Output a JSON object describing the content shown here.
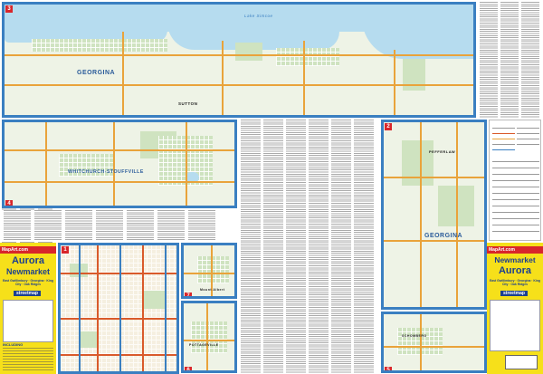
{
  "cover_left": {
    "brand": "MapArt.com",
    "title_1": "Aurora",
    "title_2": "Newmarket",
    "subtitle": "East Gwillimbury · Georgina · King City · Oak Ridges",
    "product": "streetmap",
    "including": "INCLUDING"
  },
  "cover_right": {
    "brand": "MapArt.com",
    "title_1": "Newmarket",
    "title_2": "Aurora",
    "subtitle": "East Gwillimbury · Georgina · King City · Oak Ridges",
    "product": "streetmap"
  },
  "panels": {
    "georgina_north": {
      "title": "GEORGINA",
      "number": "3",
      "towns": [
        "SUTTON"
      ],
      "water": "Lake Simcoe"
    },
    "whitchurch": {
      "title": "WHITCHURCH-STOUFFVILLE",
      "number": "4"
    },
    "georgina_east": {
      "title": "GEORGINA",
      "number": "2",
      "town": "PEFFERLAW"
    },
    "newmarket": {
      "number": "1"
    },
    "mount_albert": {
      "title": "Mount Albert",
      "number": "7"
    },
    "pottageville": {
      "title": "POTTAGEVILLE",
      "number": "6"
    },
    "schomberg": {
      "title": "SCHOMBERG",
      "number": "5"
    }
  }
}
